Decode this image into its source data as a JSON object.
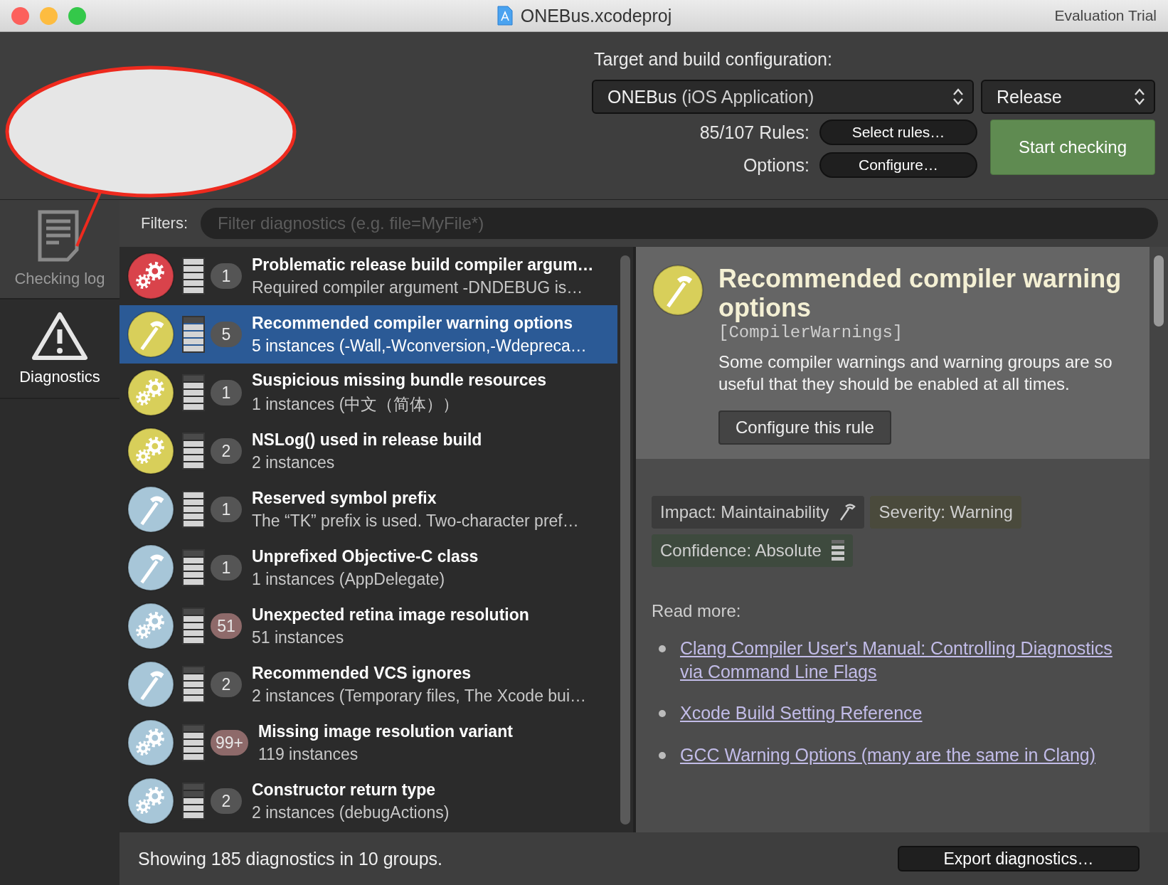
{
  "window": {
    "title": "ONEBus.xcodeproj",
    "badge": "Evaluation Trial"
  },
  "config": {
    "label": "Target and build configuration:",
    "target": "ONEBus",
    "target_detail": "(iOS Application)",
    "build": "Release",
    "rules_label": "85/107 Rules:",
    "rules_button": "Select rules…",
    "options_label": "Options:",
    "options_button": "Configure…",
    "start_button": "Start checking"
  },
  "sidebar": {
    "items": [
      {
        "label": "Checking log",
        "kind": "log",
        "selected": false
      },
      {
        "label": "Diagnostics",
        "kind": "warning",
        "selected": true
      }
    ]
  },
  "filter": {
    "label": "Filters:",
    "placeholder": "Filter diagnostics (e.g. file=MyFile*)"
  },
  "diagnostics": [
    {
      "kind": "gears",
      "color": "#d9434b",
      "level": 1,
      "badge": {
        "text": "1",
        "color": "#555555"
      },
      "title": "Problematic release build compiler argum…",
      "subtitle": "Required compiler argument -DNDEBUG is…",
      "selected": false
    },
    {
      "kind": "hammer",
      "color": "#d8cf5a",
      "level": 0.8,
      "badge": {
        "text": "5",
        "color": "#555555"
      },
      "title": "Recommended compiler warning options",
      "subtitle": "5 instances (-Wall,-Wconversion,-Wdepreca…",
      "selected": true
    },
    {
      "kind": "gears",
      "color": "#d8cf5a",
      "level": 0.8,
      "badge": {
        "text": "1",
        "color": "#555555"
      },
      "title": "Suspicious missing bundle resources",
      "subtitle": "1 instances (中文（简体））",
      "selected": false
    },
    {
      "kind": "gears",
      "color": "#d8cf5a",
      "level": 0.8,
      "badge": {
        "text": "2",
        "color": "#555555"
      },
      "title": "NSLog() used in release build",
      "subtitle": "2 instances",
      "selected": false
    },
    {
      "kind": "hammer",
      "color": "#a7c6d8",
      "level": 1,
      "badge": {
        "text": "1",
        "color": "#555555"
      },
      "title": "Reserved symbol prefix",
      "subtitle": "The “TK” prefix is used. Two-character pref…",
      "selected": false
    },
    {
      "kind": "hammer",
      "color": "#a7c6d8",
      "level": 0.8,
      "badge": {
        "text": "1",
        "color": "#555555"
      },
      "title": "Unprefixed Objective-C class",
      "subtitle": "1 instances (AppDelegate)",
      "selected": false
    },
    {
      "kind": "gears",
      "color": "#a7c6d8",
      "level": 0.8,
      "badge": {
        "text": "51",
        "color": "#8e6a6a"
      },
      "title": "Unexpected retina image resolution",
      "subtitle": "51 instances",
      "selected": false
    },
    {
      "kind": "hammer",
      "color": "#a7c6d8",
      "level": 0.8,
      "badge": {
        "text": "2",
        "color": "#555555"
      },
      "title": "Recommended VCS ignores",
      "subtitle": "2 instances (Temporary files, The Xcode bui…",
      "selected": false
    },
    {
      "kind": "gears",
      "color": "#a7c6d8",
      "level": 0.8,
      "badge": {
        "text": "99+",
        "color": "#8e6a6a"
      },
      "title": "Missing image resolution variant",
      "subtitle": "119 instances",
      "selected": false
    },
    {
      "kind": "gears",
      "color": "#a7c6d8",
      "level": 0.6,
      "badge": {
        "text": "2",
        "color": "#555555"
      },
      "title": "Constructor return type",
      "subtitle": "2 instances (debugActions)",
      "selected": false
    }
  ],
  "detail": {
    "kind": "hammer",
    "color": "#d8cf5a",
    "title": "Recommended compiler warning options",
    "identifier": "[CompilerWarnings]",
    "description": "Some compiler warnings and warning groups are so useful that they should be enabled at all times.",
    "configure_button": "Configure this rule",
    "tags": [
      {
        "text": "Impact: Maintainability",
        "kind": "hammer",
        "color": "#3b3b3b"
      },
      {
        "text": "Severity: Warning",
        "kind": "plain",
        "color": "#4a4a3c"
      },
      {
        "text": "Confidence: Absolute",
        "kind": "bars",
        "color": "#3e4a3e"
      }
    ],
    "read_more_label": "Read more:",
    "links": [
      "Clang Compiler User's Manual: Controlling Diagnostics via Command Line Flags",
      "Xcode Build Setting Reference",
      "GCC Warning Options (many are the same in Clang)"
    ]
  },
  "status": "Showing 185 diagnostics in 10 groups.",
  "export_button": "Export diagnostics…"
}
